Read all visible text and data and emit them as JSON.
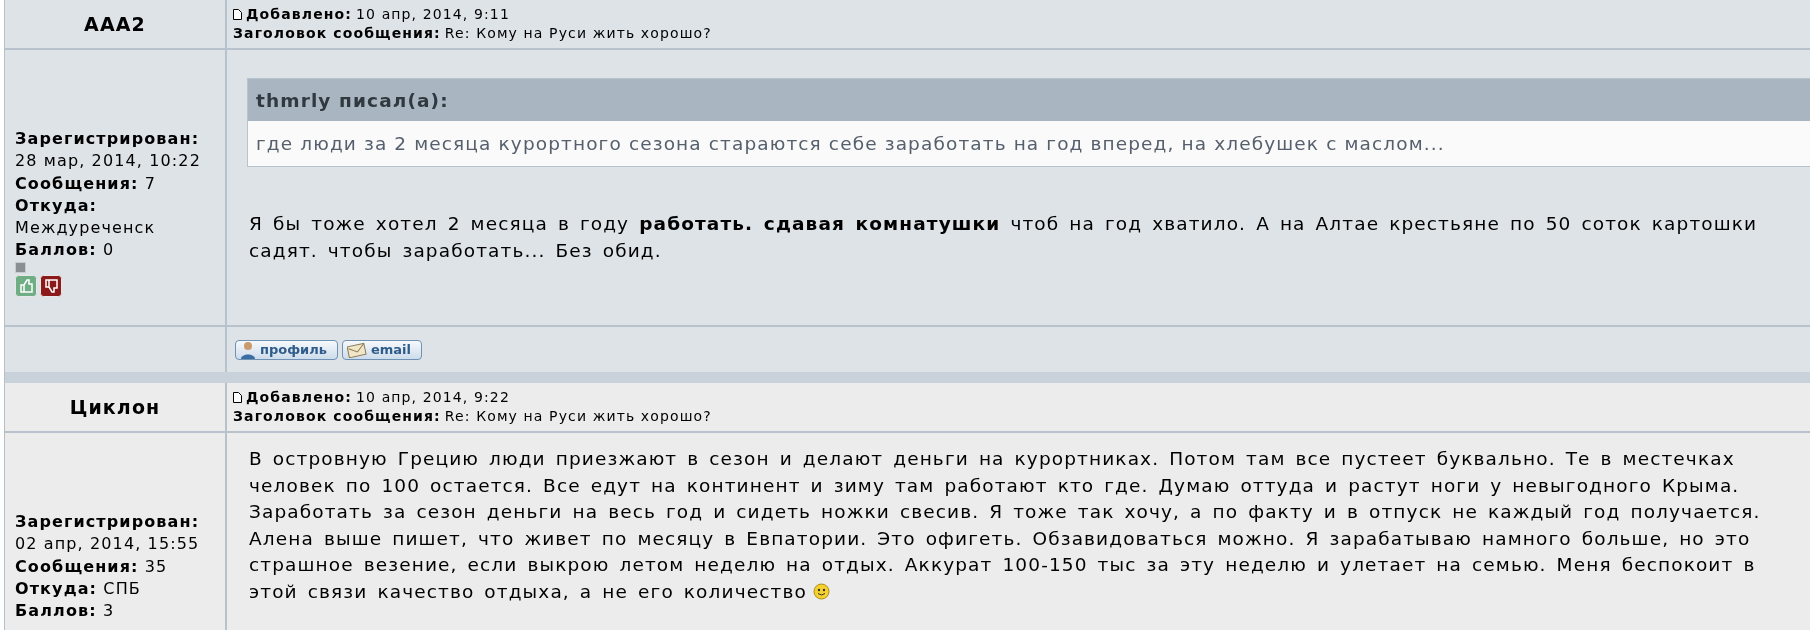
{
  "posts": [
    {
      "author": "AAA2",
      "added_label": "Добавлено:",
      "added": "10 апр, 2014, 9:11",
      "subject_label": "Заголовок сообщения:",
      "subject": "Re: Кому на Руси жить хорошо?",
      "profile": [
        {
          "label": "Зарегистрирован:",
          "value": "28 мар, 2014, 10:22",
          "break": true
        },
        {
          "label": "Сообщения:",
          "value": "7",
          "break": false
        },
        {
          "label": "Откуда:",
          "value": "Междуреченск",
          "break": true
        },
        {
          "label": "Баллов:",
          "value": "0",
          "break": false
        }
      ],
      "rank_icon": true,
      "vote_buttons": true,
      "quote": {
        "author": "thmrly писал(а):",
        "text": "где люди за 2 месяца курортного сезона стараются себе заработать на год вперед, на хлебушек с маслом..."
      },
      "body_lines": [
        "Я бы тоже хотел 2 месяца в году **работать. сдавая комнатушки** чтоб на год хватило. А на Алтае крестьяне по 50 соток картошки",
        "садят. чтобы заработать... Без обид."
      ],
      "smiley": false,
      "buttons": [
        {
          "kind": "profile",
          "label": "профиль"
        },
        {
          "kind": "email",
          "label": "email"
        }
      ]
    },
    {
      "author": "Циклон",
      "added_label": "Добавлено:",
      "added": "10 апр, 2014, 9:22",
      "subject_label": "Заголовок сообщения:",
      "subject": "Re: Кому на Руси жить хорошо?",
      "profile": [
        {
          "label": "Зарегистрирован:",
          "value": "02 апр, 2014, 15:55",
          "break": true
        },
        {
          "label": "Сообщения:",
          "value": "35",
          "break": false
        },
        {
          "label": "Откуда:",
          "value": "СПБ",
          "break": false
        },
        {
          "label": "Баллов:",
          "value": "3",
          "break": false
        }
      ],
      "rank_icon": false,
      "vote_buttons": false,
      "body_lines": [
        "В островную Грецию люди приезжают в сезон и делают деньги на курортниках. Потом там все пустеет буквально. Те в местечках",
        "человек по 100 остается. Все едут на континент и зиму там работают кто где. Думаю оттуда и растут ноги у невыгодного Крыма.",
        "Заработать за сезон деньги на весь год и сидеть ножки свесив. Я тоже так хочу, а по факту и в отпуск не каждый год получается.",
        "Алена выше пишет, что живет по месяцу в Евпатории. Это офигеть. Обзавидоваться можно. Я зарабатываю намного больше, но это",
        "страшное везение, если выкрою летом неделю на отдых. Аккурат 100-150 тыс за эту неделю и улетает на семью. Меня беспокоит в",
        "этой связи качество отдыха, а не его количество"
      ],
      "smiley": true
    }
  ]
}
